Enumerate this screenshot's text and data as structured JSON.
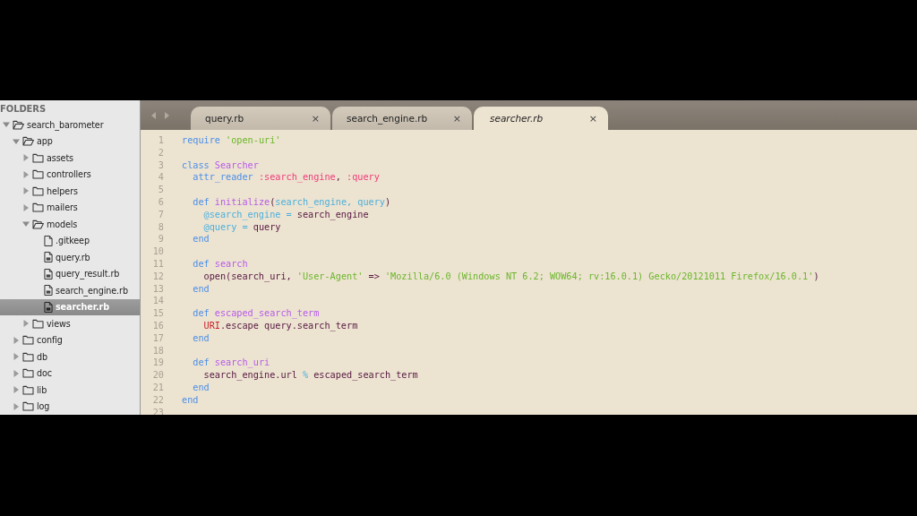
{
  "sidebar": {
    "header": "FOLDERS",
    "tree": [
      {
        "label": "search_barometer",
        "kind": "folder",
        "expanded": true,
        "selected": false,
        "children": [
          {
            "label": "app",
            "kind": "folder",
            "expanded": true,
            "selected": false,
            "children": [
              {
                "label": "assets",
                "kind": "folder",
                "expanded": false,
                "selected": false
              },
              {
                "label": "controllers",
                "kind": "folder",
                "expanded": false,
                "selected": false
              },
              {
                "label": "helpers",
                "kind": "folder",
                "expanded": false,
                "selected": false
              },
              {
                "label": "mailers",
                "kind": "folder",
                "expanded": false,
                "selected": false
              },
              {
                "label": "models",
                "kind": "folder",
                "expanded": true,
                "selected": false,
                "children": [
                  {
                    "label": ".gitkeep",
                    "kind": "file",
                    "selected": false
                  },
                  {
                    "label": "query.rb",
                    "kind": "rbfile",
                    "selected": false
                  },
                  {
                    "label": "query_result.rb",
                    "kind": "rbfile",
                    "selected": false
                  },
                  {
                    "label": "search_engine.rb",
                    "kind": "rbfile",
                    "selected": false
                  },
                  {
                    "label": "searcher.rb",
                    "kind": "rbfile",
                    "selected": true
                  }
                ]
              },
              {
                "label": "views",
                "kind": "folder",
                "expanded": false,
                "selected": false
              }
            ]
          },
          {
            "label": "config",
            "kind": "folder",
            "expanded": false,
            "selected": false
          },
          {
            "label": "db",
            "kind": "folder",
            "expanded": false,
            "selected": false
          },
          {
            "label": "doc",
            "kind": "folder",
            "expanded": false,
            "selected": false
          },
          {
            "label": "lib",
            "kind": "folder",
            "expanded": false,
            "selected": false
          },
          {
            "label": "log",
            "kind": "folder",
            "expanded": false,
            "selected": false
          }
        ]
      }
    ]
  },
  "tabs": [
    {
      "label": "query.rb",
      "close": "×",
      "selected": false
    },
    {
      "label": "search_engine.rb",
      "close": "×",
      "selected": false
    },
    {
      "label": "searcher.rb",
      "close": "×",
      "selected": true
    }
  ],
  "editor": {
    "lines": [
      {
        "number": "1",
        "tokens": [
          {
            "kind": "keyword",
            "text": "require "
          },
          {
            "kind": "string",
            "text": "'open-uri'"
          }
        ]
      },
      {
        "number": "2"
      },
      {
        "number": "3",
        "tokens": [
          {
            "kind": "keyword",
            "text": "class "
          },
          {
            "kind": "name",
            "text": "Searcher"
          }
        ]
      },
      {
        "number": "4",
        "tokens": [
          {
            "kind": "keyword",
            "text": "  attr_reader "
          },
          {
            "kind": "symbol",
            "text": ":search_engine"
          },
          {
            "kind": "plain",
            "text": ", "
          },
          {
            "kind": "symbol",
            "text": ":query"
          }
        ]
      },
      {
        "number": "5"
      },
      {
        "number": "6",
        "tokens": [
          {
            "kind": "keyword",
            "text": "  def "
          },
          {
            "kind": "name",
            "text": "initialize"
          },
          {
            "kind": "plain",
            "text": "("
          },
          {
            "kind": "param",
            "text": "search_engine, query"
          },
          {
            "kind": "plain",
            "text": ")"
          }
        ]
      },
      {
        "number": "7",
        "tokens": [
          {
            "kind": "param",
            "text": "    @search_engine ="
          },
          {
            "kind": "plain",
            "text": " search_engine"
          }
        ]
      },
      {
        "number": "8",
        "tokens": [
          {
            "kind": "param",
            "text": "    @query ="
          },
          {
            "kind": "plain",
            "text": " query"
          }
        ]
      },
      {
        "number": "9",
        "tokens": [
          {
            "kind": "keyword",
            "text": "  end"
          }
        ]
      },
      {
        "number": "10"
      },
      {
        "number": "11",
        "tokens": [
          {
            "kind": "keyword",
            "text": "  def "
          },
          {
            "kind": "name",
            "text": "search"
          }
        ]
      },
      {
        "number": "12",
        "tokens": [
          {
            "kind": "plain",
            "text": "    open(search_uri, "
          },
          {
            "kind": "string",
            "text": "'User-Agent'"
          },
          {
            "kind": "plain",
            "text": " => "
          },
          {
            "kind": "string",
            "text": "'Mozilla/6.0 (Windows NT 6.2; WOW64; rv:16.0.1) Gecko/20121011 Firefox/16.0.1'"
          },
          {
            "kind": "plain",
            "text": ")"
          }
        ]
      },
      {
        "number": "13",
        "tokens": [
          {
            "kind": "keyword",
            "text": "  end"
          }
        ]
      },
      {
        "number": "14"
      },
      {
        "number": "15",
        "tokens": [
          {
            "kind": "keyword",
            "text": "  def "
          },
          {
            "kind": "name",
            "text": "escaped_search_term"
          }
        ]
      },
      {
        "number": "16",
        "tokens": [
          {
            "kind": "const",
            "text": "    URI"
          },
          {
            "kind": "plain",
            "text": ".escape query.search_term"
          }
        ]
      },
      {
        "number": "17",
        "tokens": [
          {
            "kind": "keyword",
            "text": "  end"
          }
        ]
      },
      {
        "number": "18"
      },
      {
        "number": "19",
        "tokens": [
          {
            "kind": "keyword",
            "text": "  def "
          },
          {
            "kind": "name",
            "text": "search_uri"
          }
        ]
      },
      {
        "number": "20",
        "tokens": [
          {
            "kind": "plain",
            "text": "    search_engine.url "
          },
          {
            "kind": "param",
            "text": "%"
          },
          {
            "kind": "plain",
            "text": " escaped_search_term"
          }
        ]
      },
      {
        "number": "21",
        "tokens": [
          {
            "kind": "keyword",
            "text": "  end"
          }
        ]
      },
      {
        "number": "22",
        "tokens": [
          {
            "kind": "keyword",
            "text": "end"
          }
        ]
      },
      {
        "number": "23"
      }
    ]
  }
}
